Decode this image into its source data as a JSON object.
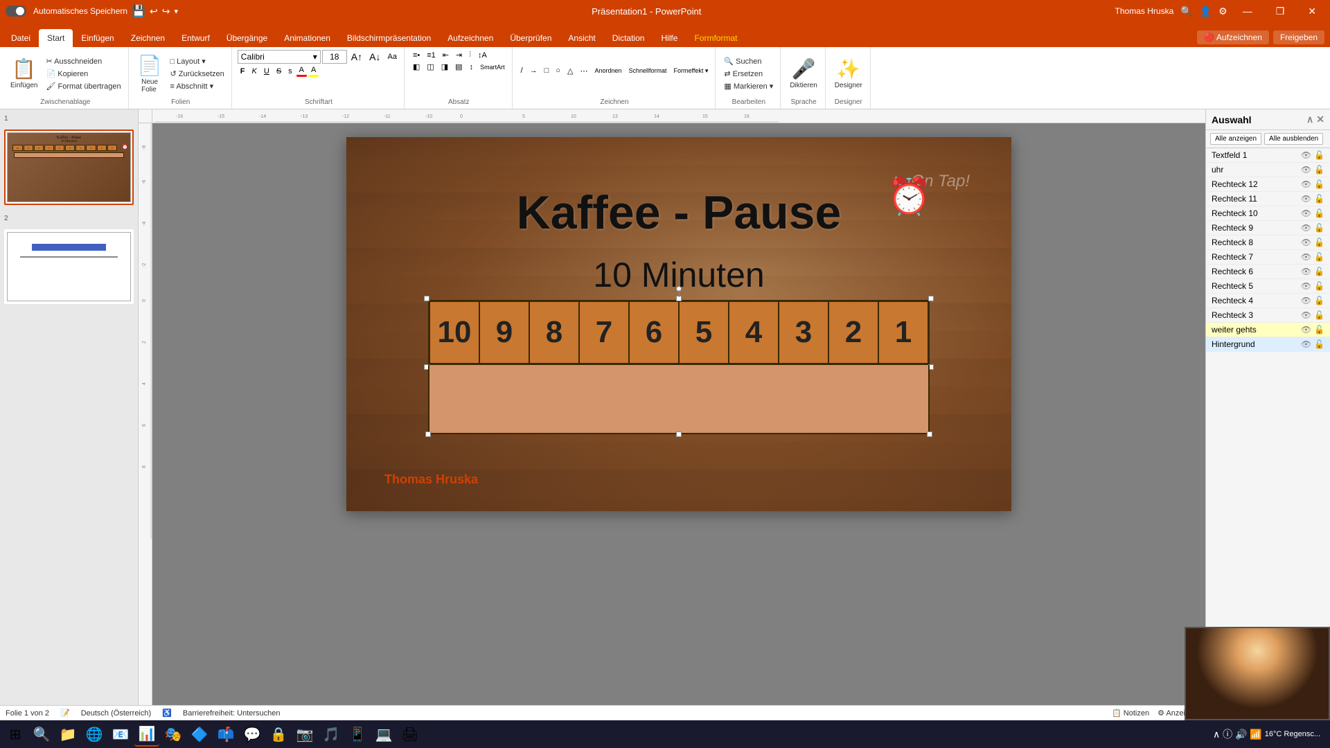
{
  "titlebar": {
    "autosave_label": "Automatisches Speichern",
    "title": "Präsentation1 - PowerPoint",
    "user": "Thomas Hruska",
    "search_placeholder": "Suchen",
    "win_minimize": "—",
    "win_restore": "❐",
    "win_close": "✕"
  },
  "ribbon_tabs": {
    "items": [
      "Datei",
      "Start",
      "Einfügen",
      "Zeichnen",
      "Entwurf",
      "Übergänge",
      "Animationen",
      "Bildschirmpräsentation",
      "Aufzeichnen",
      "Überprüfen",
      "Ansicht",
      "Dictation",
      "Hilfe",
      "Formformat"
    ],
    "active": "Start",
    "right_buttons": [
      "Aufzeichnen",
      "Freigeben"
    ]
  },
  "ribbon": {
    "groups": [
      {
        "label": "Zwischenablage",
        "items": [
          "Einfügen",
          "Ausschneiden",
          "Kopieren",
          "Format übertragen"
        ]
      },
      {
        "label": "Folien",
        "items": [
          "Neue Folie",
          "Layout",
          "Zurücksetzen",
          "Abschnitt"
        ]
      },
      {
        "label": "Schriftart",
        "font_name": "Calibri",
        "font_size": "18",
        "items": [
          "F",
          "K",
          "U",
          "S"
        ]
      },
      {
        "label": "Absatz",
        "items": []
      },
      {
        "label": "Zeichnen",
        "items": []
      },
      {
        "label": "Bearbeiten",
        "items": [
          "Suchen",
          "Ersetzen",
          "Markieren"
        ]
      },
      {
        "label": "Sprache",
        "items": [
          "Diktieren"
        ]
      },
      {
        "label": "Designer",
        "items": [
          "Designer"
        ]
      }
    ]
  },
  "slides": [
    {
      "number": 1,
      "title": "Kaffee - Pause",
      "subtitle": "10 Minuten",
      "active": true,
      "has_alarm": true,
      "has_countdown": true
    },
    {
      "number": 2,
      "title": "",
      "active": false,
      "has_blue_bar": true
    }
  ],
  "slide": {
    "title": "Kaffee - Pause",
    "subtitle": "10 Minuten",
    "countdown": [
      "10",
      "9",
      "8",
      "7",
      "6",
      "5",
      "4",
      "3",
      "2",
      "1"
    ],
    "presenter": "Thomas Hruska"
  },
  "right_panel": {
    "title": "Auswahl",
    "btn_show_all": "Alle anzeigen",
    "btn_hide_all": "Alle ausblenden",
    "layers": [
      {
        "name": "Textfeld 1",
        "visible": true,
        "selected": false,
        "highlighted": false
      },
      {
        "name": "uhr",
        "visible": true,
        "selected": false,
        "highlighted": false
      },
      {
        "name": "Rechteck 12",
        "visible": true,
        "selected": false,
        "highlighted": false
      },
      {
        "name": "Rechteck 11",
        "visible": true,
        "selected": false,
        "highlighted": false
      },
      {
        "name": "Rechteck 10",
        "visible": true,
        "selected": false,
        "highlighted": false
      },
      {
        "name": "Rechteck 9",
        "visible": true,
        "selected": false,
        "highlighted": false
      },
      {
        "name": "Rechteck 8",
        "visible": true,
        "selected": false,
        "highlighted": false
      },
      {
        "name": "Rechteck 7",
        "visible": true,
        "selected": false,
        "highlighted": false
      },
      {
        "name": "Rechteck 6",
        "visible": true,
        "selected": false,
        "highlighted": false
      },
      {
        "name": "Rechteck 5",
        "visible": true,
        "selected": false,
        "highlighted": false
      },
      {
        "name": "Rechteck 4",
        "visible": true,
        "selected": false,
        "highlighted": false
      },
      {
        "name": "Rechteck 3",
        "visible": true,
        "selected": false,
        "highlighted": false
      },
      {
        "name": "weiter gehts",
        "visible": true,
        "selected": false,
        "highlighted": true
      },
      {
        "name": "Hintergrund",
        "visible": true,
        "selected": true,
        "highlighted": false
      }
    ]
  },
  "statusbar": {
    "slide_info": "Folie 1 von 2",
    "language": "Deutsch (Österreich)",
    "accessibility": "Barrierefreiheit: Untersuchen",
    "notes": "Notizen",
    "view_settings": "Anzeigeeinstellungen"
  },
  "taskbar": {
    "items": [
      "⊞",
      "🔍",
      "📁",
      "🌐",
      "📧",
      "🖥",
      "🔒",
      "📷",
      "🎵",
      "📱",
      "📊",
      "📝",
      "🎮",
      "💬",
      "🌍",
      "⌨",
      "💻",
      "🖨"
    ],
    "clock": "16°C  Regensc...",
    "time": ""
  },
  "video": {
    "visible": true
  }
}
